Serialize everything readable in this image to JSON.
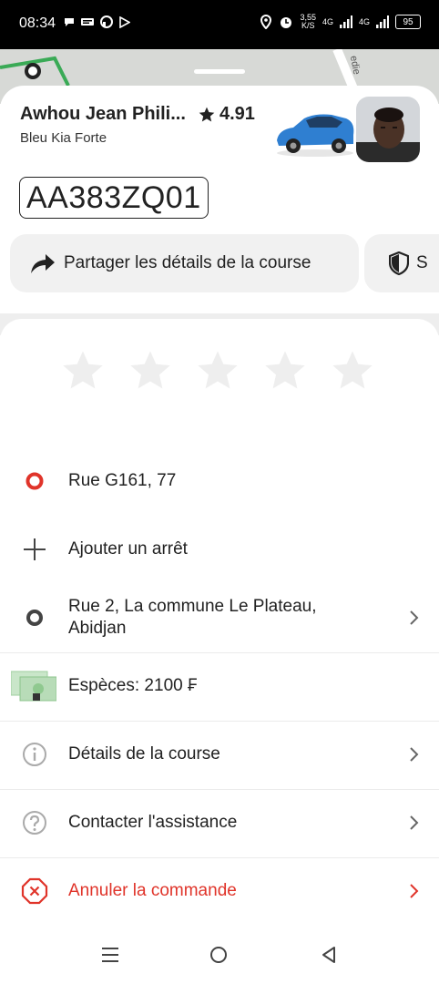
{
  "status_bar": {
    "time": "08:34",
    "net_speed": "3,55",
    "net_unit": "K/S",
    "net1": "4G",
    "net2": "4G",
    "battery": "95"
  },
  "map": {
    "street_fragment": "edie"
  },
  "driver": {
    "name": "Awhou Jean Phili...",
    "rating": "4.91",
    "car_model": "Bleu Kia Forte",
    "plate": "AA383ZQ01"
  },
  "actions": {
    "share_label": "Partager les détails de la course",
    "safety_label": "S"
  },
  "rating_stars": {
    "count": 5,
    "selected": 0
  },
  "trip": {
    "pickup": "Rue G161, 77",
    "add_stop": "Ajouter un arrêt",
    "destination_line1": "Rue 2, La commune Le Plateau,",
    "destination_line2": "Abidjan",
    "payment": "Espèces: 2100 ₣",
    "details": "Détails de la course",
    "support": "Contacter l'assistance",
    "cancel": "Annuler la commande"
  },
  "colors": {
    "accent_red": "#e0342a",
    "chip_bg": "#f1f1f1",
    "star": "#eeeeee"
  }
}
